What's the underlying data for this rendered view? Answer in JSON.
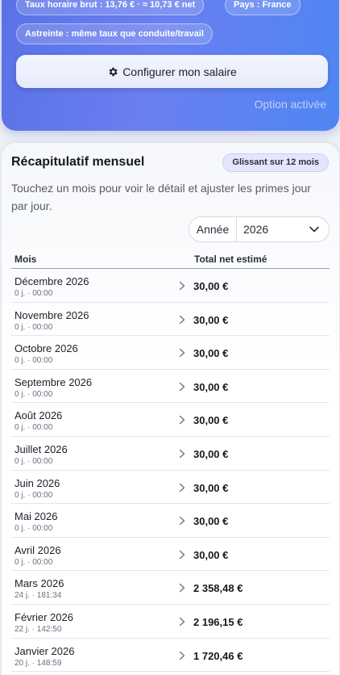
{
  "header": {
    "rate_chip": "Taux horaire brut : 13,76 € · ≈ 10,73 € net",
    "country_chip": "Pays : France",
    "astreinte_chip": "Astreinte : même taux que conduite/travail",
    "config_button_label": "Configurer mon salaire",
    "option_status": "Option activée",
    "accent_color": "#5a72e6"
  },
  "summary": {
    "title": "Récapitulatif mensuel",
    "window_badge": "Glissant sur 12 mois",
    "hint": "Touchez un mois pour voir le détail et ajuster les primes jour par jour.",
    "year_label": "Année",
    "year_value": "2026"
  },
  "table": {
    "col_month": "Mois",
    "col_total": "Total net estimé",
    "rows": [
      {
        "month": "Décembre 2026",
        "detail": "0 j. · 00:00",
        "total": "30,00 €"
      },
      {
        "month": "Novembre 2026",
        "detail": "0 j. · 00:00",
        "total": "30,00 €"
      },
      {
        "month": "Octobre 2026",
        "detail": "0 j. · 00:00",
        "total": "30,00 €"
      },
      {
        "month": "Septembre 2026",
        "detail": "0 j. · 00:00",
        "total": "30,00 €"
      },
      {
        "month": "Août 2026",
        "detail": "0 j. · 00:00",
        "total": "30,00 €"
      },
      {
        "month": "Juillet 2026",
        "detail": "0 j. · 00:00",
        "total": "30,00 €"
      },
      {
        "month": "Juin 2026",
        "detail": "0 j. · 00:00",
        "total": "30,00 €"
      },
      {
        "month": "Mai 2026",
        "detail": "0 j. · 00:00",
        "total": "30,00 €"
      },
      {
        "month": "Avril 2026",
        "detail": "0 j. · 00:00",
        "total": "30,00 €"
      },
      {
        "month": "Mars 2026",
        "detail": "24 j. · 181:34",
        "total": "2 358,48 €"
      },
      {
        "month": "Février 2026",
        "detail": "22 j. · 142:50",
        "total": "2 196,15 €"
      },
      {
        "month": "Janvier 2026",
        "detail": "20 j. · 148:59",
        "total": "1 720,46 €"
      }
    ]
  }
}
